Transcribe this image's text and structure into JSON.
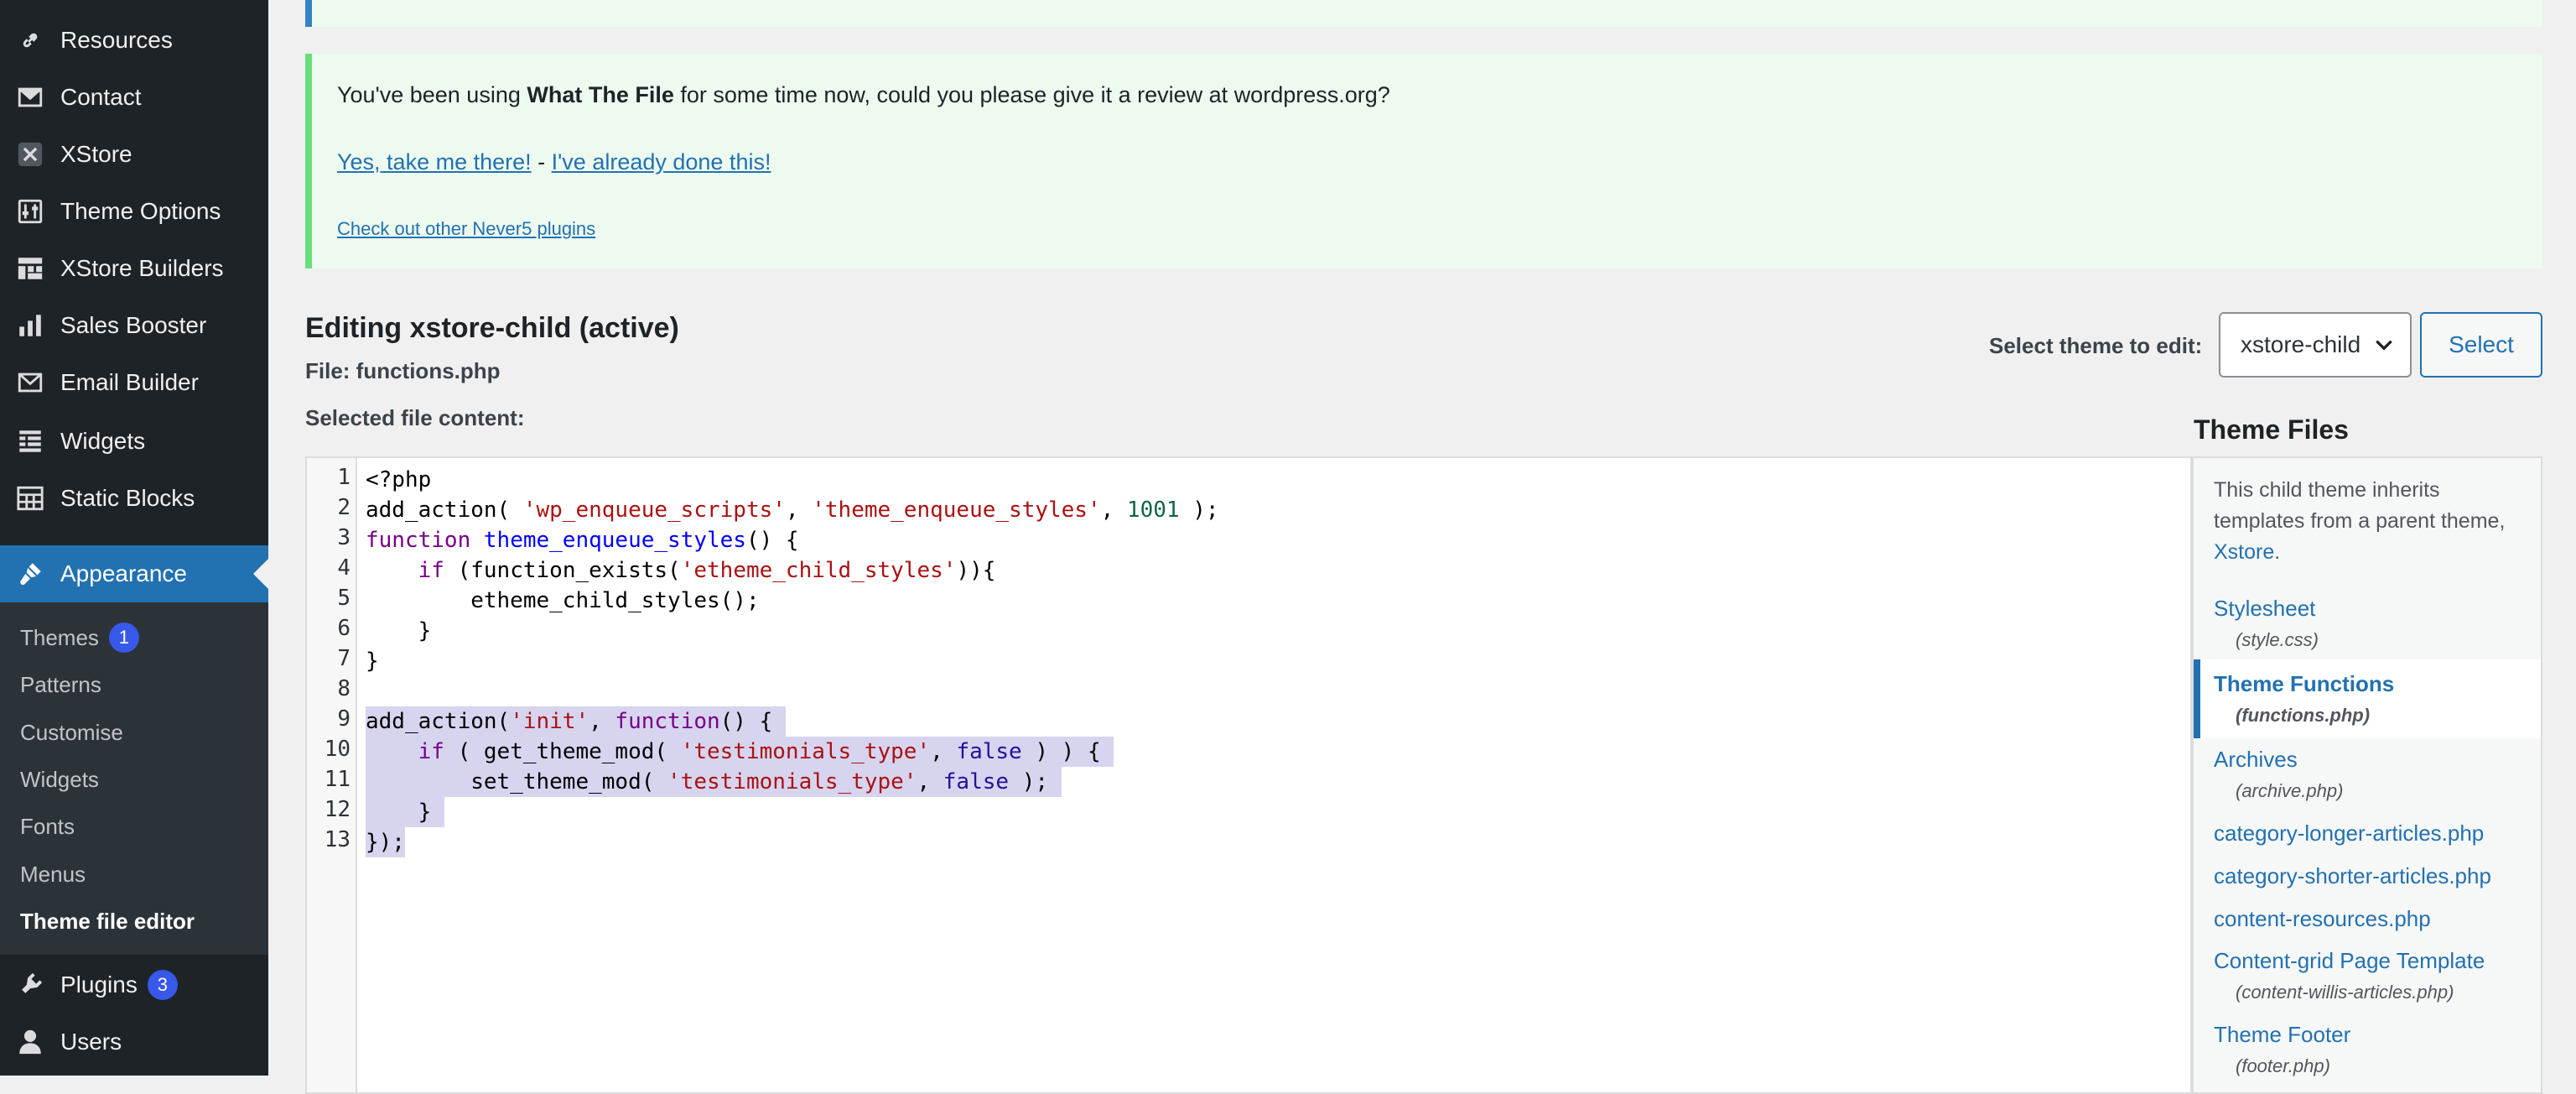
{
  "sidebar": {
    "items": [
      {
        "label": "Resources",
        "icon": "link-icon"
      },
      {
        "label": "Contact",
        "icon": "envelope-icon"
      },
      {
        "label": "XStore",
        "icon": "xstore-icon"
      },
      {
        "label": "Theme Options",
        "icon": "sliders-icon"
      },
      {
        "label": "XStore Builders",
        "icon": "grid-icon"
      },
      {
        "label": "Sales Booster",
        "icon": "bar-chart-icon"
      },
      {
        "label": "Email Builder",
        "icon": "envelope-icon"
      },
      {
        "label": "Widgets",
        "icon": "list-icon"
      },
      {
        "label": "Static Blocks",
        "icon": "table-icon"
      },
      {
        "label": "Appearance",
        "icon": "brush-icon"
      }
    ],
    "appearance_submenu": [
      {
        "label": "Themes",
        "badge": "1"
      },
      {
        "label": "Patterns"
      },
      {
        "label": "Customise"
      },
      {
        "label": "Widgets"
      },
      {
        "label": "Fonts"
      },
      {
        "label": "Menus"
      },
      {
        "label": "Theme file editor"
      }
    ],
    "bottom_items": [
      {
        "label": "Plugins",
        "badge": "3",
        "icon": "plug-icon"
      },
      {
        "label": "Users",
        "icon": "user-icon"
      }
    ]
  },
  "notice": {
    "text_prefix": "You've been using ",
    "plugin_name": "What The File",
    "text_suffix": " for some time now, could you please give it a review at wordpress.org?",
    "link_yes": "Yes, take me there!",
    "separator": " - ",
    "link_done": "I've already done this!",
    "link_other": "Check out other Never5 plugins"
  },
  "editor": {
    "title": "Editing xstore-child (active)",
    "file_label": "File: functions.php",
    "selected_label": "Selected file content:",
    "select_theme_label": "Select theme to edit:",
    "selected_theme": "xstore-child",
    "select_button": "Select"
  },
  "code": {
    "line_numbers": [
      "1",
      "2",
      "3",
      "4",
      "5",
      "6",
      "7",
      "8",
      "9",
      "10",
      "11",
      "12",
      "13"
    ]
  },
  "theme_files": {
    "title": "Theme Files",
    "description": "This child theme inherits templates from a parent theme, ",
    "parent_link": "Xstore",
    "description_end": ".",
    "files": [
      {
        "name": "Stylesheet",
        "file": "(style.css)"
      },
      {
        "name": "Theme Functions",
        "file": "(functions.php)"
      },
      {
        "name": "Archives",
        "file": "(archive.php)"
      },
      {
        "name": "category-longer-articles.php",
        "file": ""
      },
      {
        "name": "category-shorter-articles.php",
        "file": ""
      },
      {
        "name": "content-resources.php",
        "file": ""
      },
      {
        "name": "Content-grid Page Template",
        "file": "(content-willis-articles.php)"
      },
      {
        "name": "Theme Footer",
        "file": "(footer.php)"
      }
    ]
  },
  "colors": {
    "sidebar_bg": "#1d2327",
    "accent": "#2271b1",
    "badge": "#3858e9",
    "notice_green": "#68de7c"
  }
}
